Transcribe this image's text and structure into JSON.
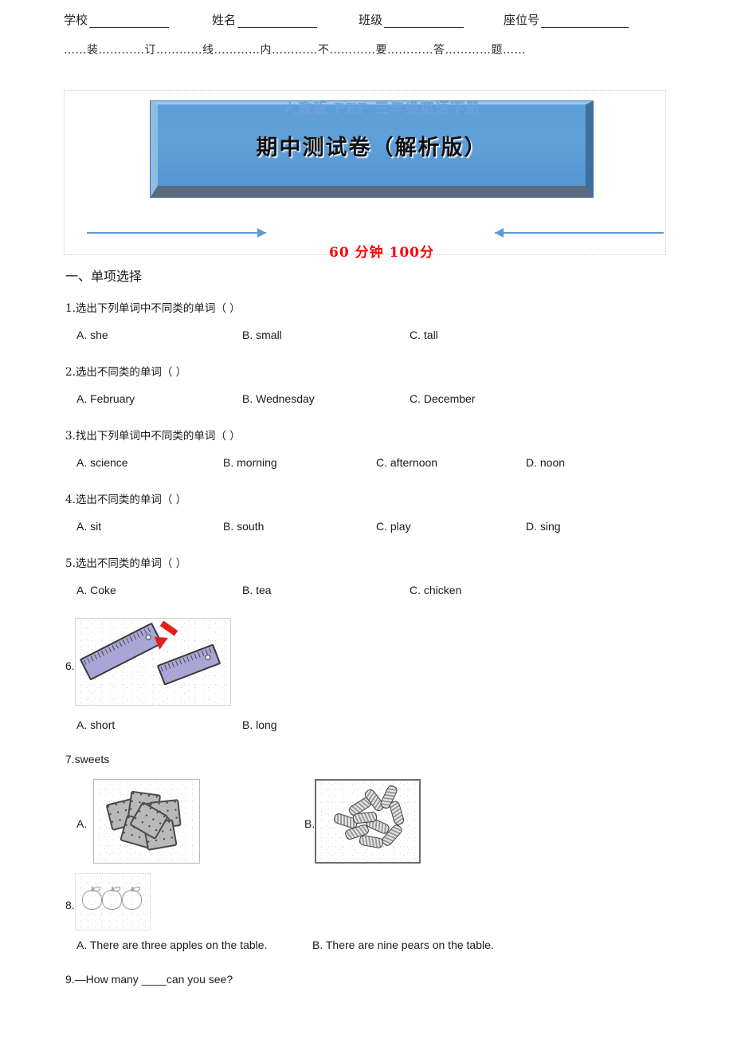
{
  "header": {
    "fields": [
      {
        "label": "学校",
        "value": ""
      },
      {
        "label": "姓名",
        "value": ""
      },
      {
        "label": "班级",
        "value": ""
      },
      {
        "label": "座位号",
        "value": ""
      }
    ],
    "seal_line": "……装…………订…………线…………内…………不…………要…………答…………题……"
  },
  "title_block": {
    "banner_title": "期中测试卷（解析版）",
    "subtitle": "人教版 PEP 三年级英语下册",
    "score_line": "60 分钟  100分",
    "accent_blue": "#5b9bd5",
    "banner_blue": "#5d9ed8",
    "score_red": "#fe0000"
  },
  "sections": [
    {
      "title": "一、单项选择"
    }
  ],
  "questions": [
    {
      "number": "1.",
      "stem": "1.选出下列单词中不同类的单词（        ）",
      "options": [
        "A. she",
        "B. small",
        "C. tall"
      ]
    },
    {
      "number": "2.",
      "stem": "2.选出不同类的单词（      ）",
      "options": [
        "A. February",
        "B. Wednesday",
        "C. December"
      ]
    },
    {
      "number": "3.",
      "stem": "3.找出下列单词中不同类的单词（       ）",
      "options": [
        "A. science",
        "B. morning",
        "C. afternoon",
        "D. noon"
      ]
    },
    {
      "number": "4.",
      "stem": "4.选出不同类的单词（      ）",
      "options": [
        "A. sit",
        "B. south",
        "C. play",
        "D. sing"
      ]
    },
    {
      "number": "5.",
      "stem": "5.选出不同类的单词（      ）",
      "options": [
        "A. Coke",
        "B. tea",
        "C. chicken"
      ]
    },
    {
      "number": "6.",
      "stem": "",
      "image_alt": "两把尺子，红色箭头指向较长的一把",
      "options": [
        "A. short",
        "B. long"
      ]
    },
    {
      "number": "7.",
      "stem": "7.sweets",
      "label_a": "A.",
      "label_b": "B.",
      "image_alt_a": "一堆饼干",
      "image_alt_b": "一堆糖果"
    },
    {
      "number": "8.",
      "stem": "",
      "image_alt": "三个苹果",
      "options": [
        "A. There are three apples on the table.",
        "B. There are nine pears on the table."
      ]
    },
    {
      "number": "9.",
      "stem": "9.—How many ____can you see?",
      "options": []
    }
  ]
}
